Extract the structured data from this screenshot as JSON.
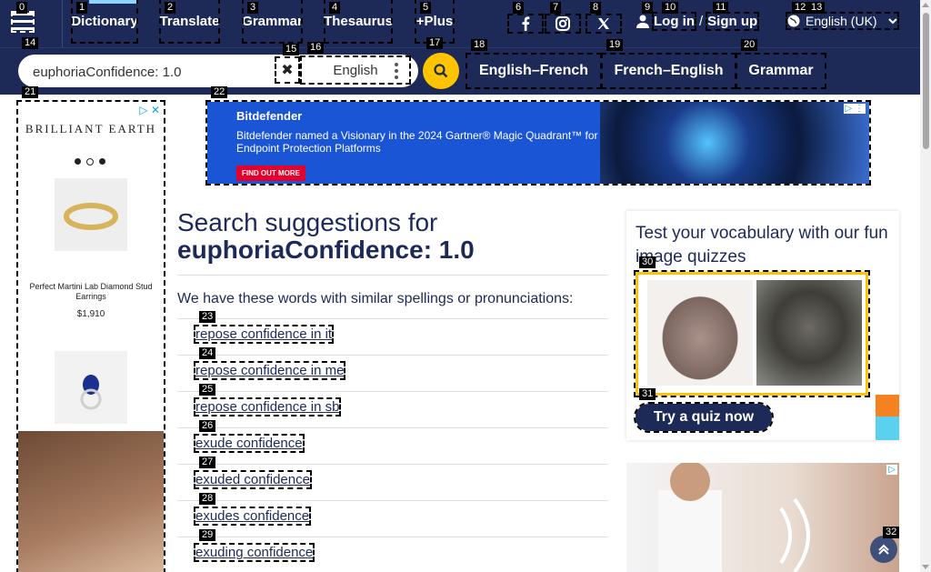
{
  "header": {
    "nav": [
      {
        "label": "Dictionary",
        "badge": "1"
      },
      {
        "label": "Translate",
        "badge": "2"
      },
      {
        "label": "Grammar",
        "badge": "3"
      },
      {
        "label": "Thesaurus",
        "badge": "4"
      },
      {
        "label": "+Plus",
        "badge": "5"
      }
    ],
    "menu_badge": "0",
    "social_badges": [
      "6",
      "7",
      "8"
    ],
    "login": {
      "login_label": "Log in",
      "sep": "/",
      "signup_label": "Sign up",
      "badges": [
        "9",
        "10",
        "11"
      ]
    },
    "language": {
      "label": "English (UK)",
      "badges": [
        "12",
        "13"
      ]
    }
  },
  "search": {
    "value": "euphoriaConfidence: 1.0",
    "dictionary": "English",
    "badges": {
      "input": "14",
      "clear": "15",
      "dict": "16",
      "go": "17"
    },
    "quick_links": [
      {
        "label": "English–French",
        "badge": "18"
      },
      {
        "label": "French–English",
        "badge": "19"
      },
      {
        "label": "Grammar",
        "badge": "20"
      }
    ]
  },
  "ads": {
    "left": {
      "badge": "21",
      "brand": "BRILLIANT EARTH",
      "product_name": "Perfect Martini Lab Diamond Stud Earrings",
      "price": "$1,910"
    },
    "top": {
      "badge": "22",
      "logo": "Bitdefender",
      "headline": "Bitdefender named a Visionary in the 2024 Gartner® Magic Quadrant™ for Endpoint Protection Platforms",
      "cta": "FIND OUT MORE"
    }
  },
  "main": {
    "title_prefix": "Search suggestions for",
    "term": "euphoriaConfidence: 1.0",
    "intro": "We have these words with similar spellings or pronunciations:",
    "suggestions": [
      {
        "text": "repose confidence in it",
        "badge": "23"
      },
      {
        "text": "repose confidence in me",
        "badge": "24"
      },
      {
        "text": "repose confidence in sb",
        "badge": "25"
      },
      {
        "text": "exude confidence",
        "badge": "26"
      },
      {
        "text": "exuded confidence",
        "badge": "27"
      },
      {
        "text": "exudes confidence",
        "badge": "28"
      },
      {
        "text": "exuding confidence",
        "badge": "29"
      }
    ]
  },
  "quiz": {
    "title": "Test your vocabulary with our fun image quizzes",
    "images_badge": "30",
    "button_label": "Try a quiz now",
    "button_badge": "31"
  },
  "back_to_top_badge": "32",
  "colors": {
    "navy": "#1d2a57",
    "yellow": "#fec400",
    "link": "#1d2a57"
  }
}
